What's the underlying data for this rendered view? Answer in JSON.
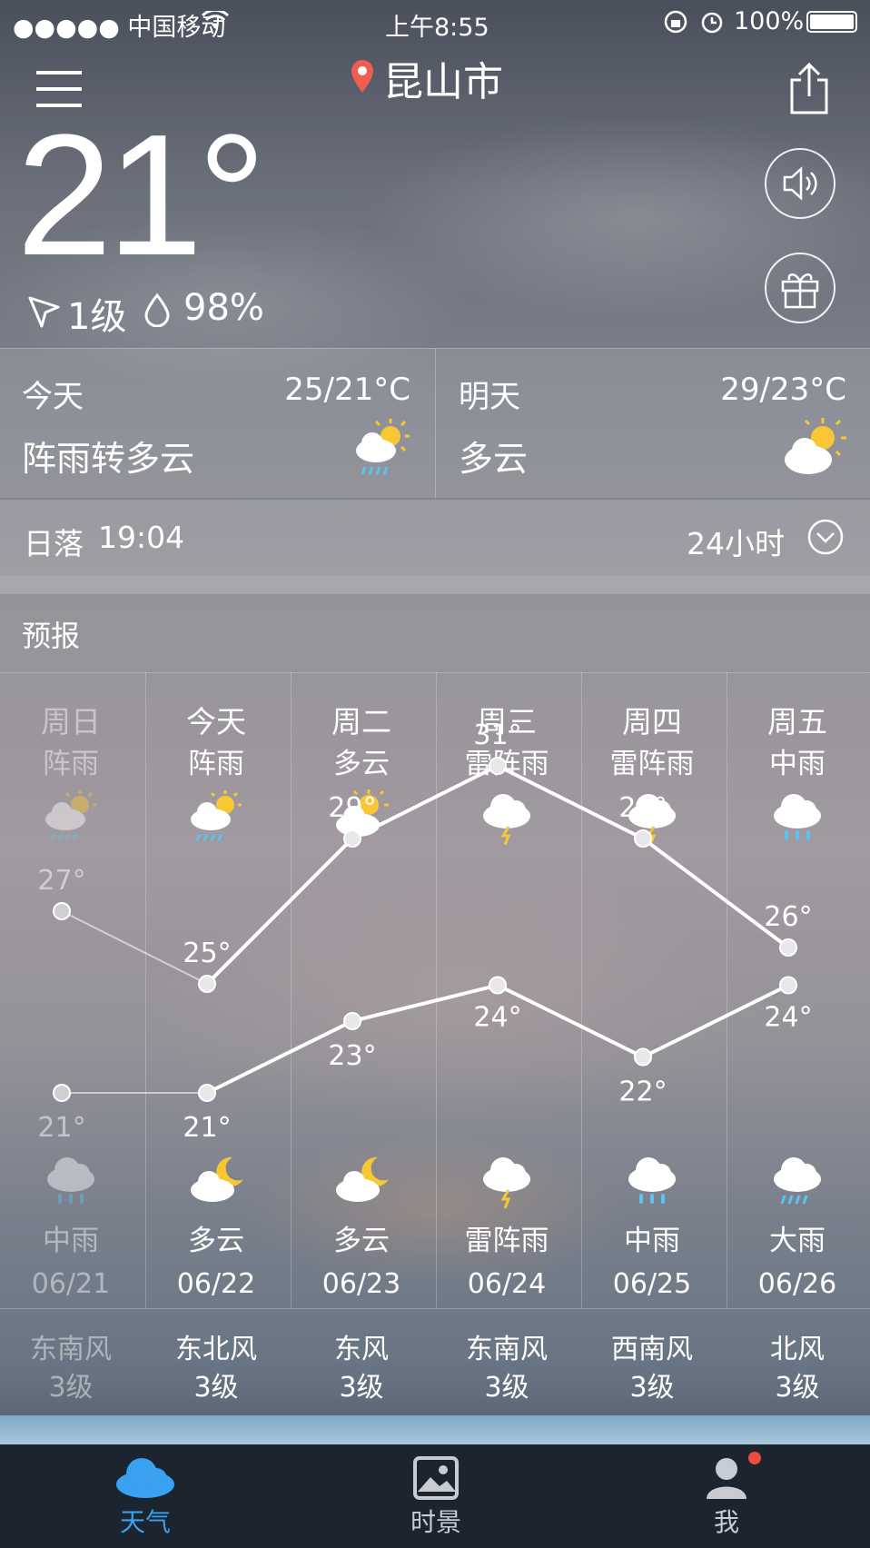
{
  "status_bar": {
    "carrier": "●●●●● 中国移动",
    "time": "上午8:55",
    "battery": "100%"
  },
  "header": {
    "city": "昆山市"
  },
  "current": {
    "temperature": "21°",
    "wind": "1级",
    "humidity": "98%"
  },
  "today": {
    "label": "今天",
    "range": "25/21°C",
    "condition": "阵雨转多云"
  },
  "tomorrow": {
    "label": "明天",
    "range": "29/23°C",
    "condition": "多云"
  },
  "sun": {
    "label": "日落",
    "time": "19:04",
    "toggle": "24小时"
  },
  "forecast": {
    "title": "预报",
    "days": [
      {
        "day": "周日",
        "cond_day": "阵雨",
        "high": "27°",
        "low": "21°",
        "cond_night": "中雨",
        "date": "06/21",
        "wind_dir": "东南风",
        "wind_lvl": "3级",
        "past": true,
        "icon_day": "sun-cloud-rain-icon",
        "icon_night": "cloud-rain-icon"
      },
      {
        "day": "今天",
        "cond_day": "阵雨",
        "high": "25°",
        "low": "21°",
        "cond_night": "多云",
        "date": "06/22",
        "wind_dir": "东北风",
        "wind_lvl": "3级",
        "past": false,
        "icon_day": "sun-cloud-rain-icon",
        "icon_night": "moon-cloud-icon"
      },
      {
        "day": "周二",
        "cond_day": "多云",
        "high": "29°",
        "low": "23°",
        "cond_night": "多云",
        "date": "06/23",
        "wind_dir": "东风",
        "wind_lvl": "3级",
        "past": false,
        "icon_day": "sun-cloud-icon",
        "icon_night": "moon-cloud-icon"
      },
      {
        "day": "周三",
        "cond_day": "雷阵雨",
        "high": "31°",
        "low": "24°",
        "cond_night": "雷阵雨",
        "date": "06/24",
        "wind_dir": "东南风",
        "wind_lvl": "3级",
        "past": false,
        "icon_day": "thunder-cloud-icon",
        "icon_night": "thunder-cloud-icon"
      },
      {
        "day": "周四",
        "cond_day": "雷阵雨",
        "high": "29°",
        "low": "22°",
        "cond_night": "中雨",
        "date": "06/25",
        "wind_dir": "西南风",
        "wind_lvl": "3级",
        "past": false,
        "icon_day": "thunder-cloud-icon",
        "icon_night": "cloud-rain-icon"
      },
      {
        "day": "周五",
        "cond_day": "中雨",
        "high": "26°",
        "low": "24°",
        "cond_night": "大雨",
        "date": "06/26",
        "wind_dir": "北风",
        "wind_lvl": "3级",
        "past": false,
        "icon_day": "cloud-rain-icon",
        "icon_night": "cloud-heavy-rain-icon"
      }
    ]
  },
  "chart_data": {
    "type": "line",
    "categories": [
      "06/21",
      "06/22",
      "06/23",
      "06/24",
      "06/25",
      "06/26"
    ],
    "series": [
      {
        "values": [
          27,
          25,
          29,
          31,
          29,
          26
        ]
      },
      {
        "values": [
          21,
          21,
          23,
          24,
          22,
          24
        ]
      }
    ]
  },
  "tabbar": {
    "items": [
      {
        "label": "天气",
        "active": true
      },
      {
        "label": "时景",
        "active": false
      },
      {
        "label": "我",
        "active": false
      }
    ],
    "active_color": "#3aa0f0"
  }
}
